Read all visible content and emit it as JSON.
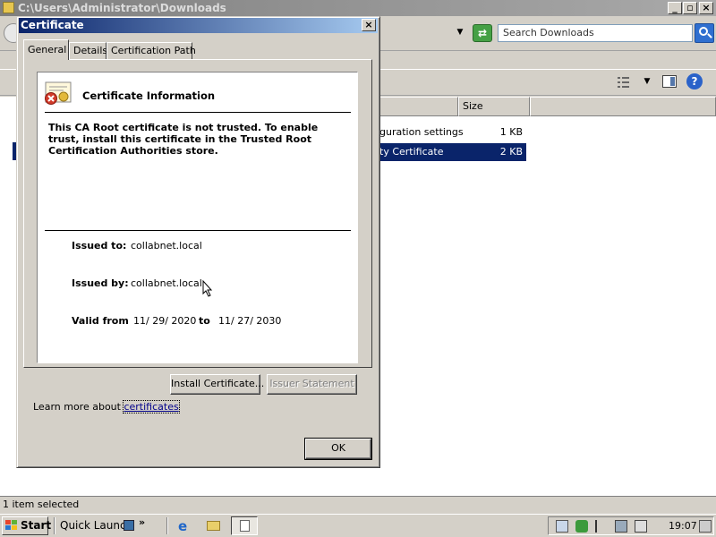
{
  "explorer": {
    "title": "C:\\Users\\Administrator\\Downloads",
    "search_placeholder": "Search Downloads",
    "columns": [
      {
        "label": "Size"
      }
    ],
    "files": [
      {
        "name": "guration settings",
        "size": "1 KB",
        "selected": false
      },
      {
        "name": "ty Certificate",
        "size": "2 KB",
        "selected": true
      }
    ],
    "status": "1 item selected"
  },
  "dialog": {
    "title": "Certificate",
    "tabs": [
      {
        "label": "General",
        "active": true
      },
      {
        "label": "Details",
        "active": false
      },
      {
        "label": "Certification Path",
        "active": false
      }
    ],
    "info_title": "Certificate Information",
    "warning": "This CA Root certificate is not trusted. To enable trust, install this certificate in the Trusted Root Certification Authorities store.",
    "issued_to_label": "Issued to:",
    "issued_to": "collabnet.local",
    "issued_by_label": "Issued by:",
    "issued_by": "collabnet.local",
    "valid_from_label": "Valid from",
    "valid_from": "11/ 29/ 2020",
    "to_label": "to",
    "valid_to": "11/ 27/ 2030",
    "install_button": "Install Certificate...",
    "issuer_statement_button": "Issuer Statement",
    "learn_prefix": "Learn more about ",
    "learn_link": "certificates",
    "ok_button": "OK"
  },
  "taskbar": {
    "start": "Start",
    "quick_launch": "Quick Launch",
    "more": "»",
    "clock": "19:07"
  },
  "icons": {
    "close": "close-icon",
    "minimize": "minimize-icon",
    "restore": "restore-icon",
    "search": "search-icon",
    "help": "help-icon",
    "certificate": "certificate-icon"
  }
}
